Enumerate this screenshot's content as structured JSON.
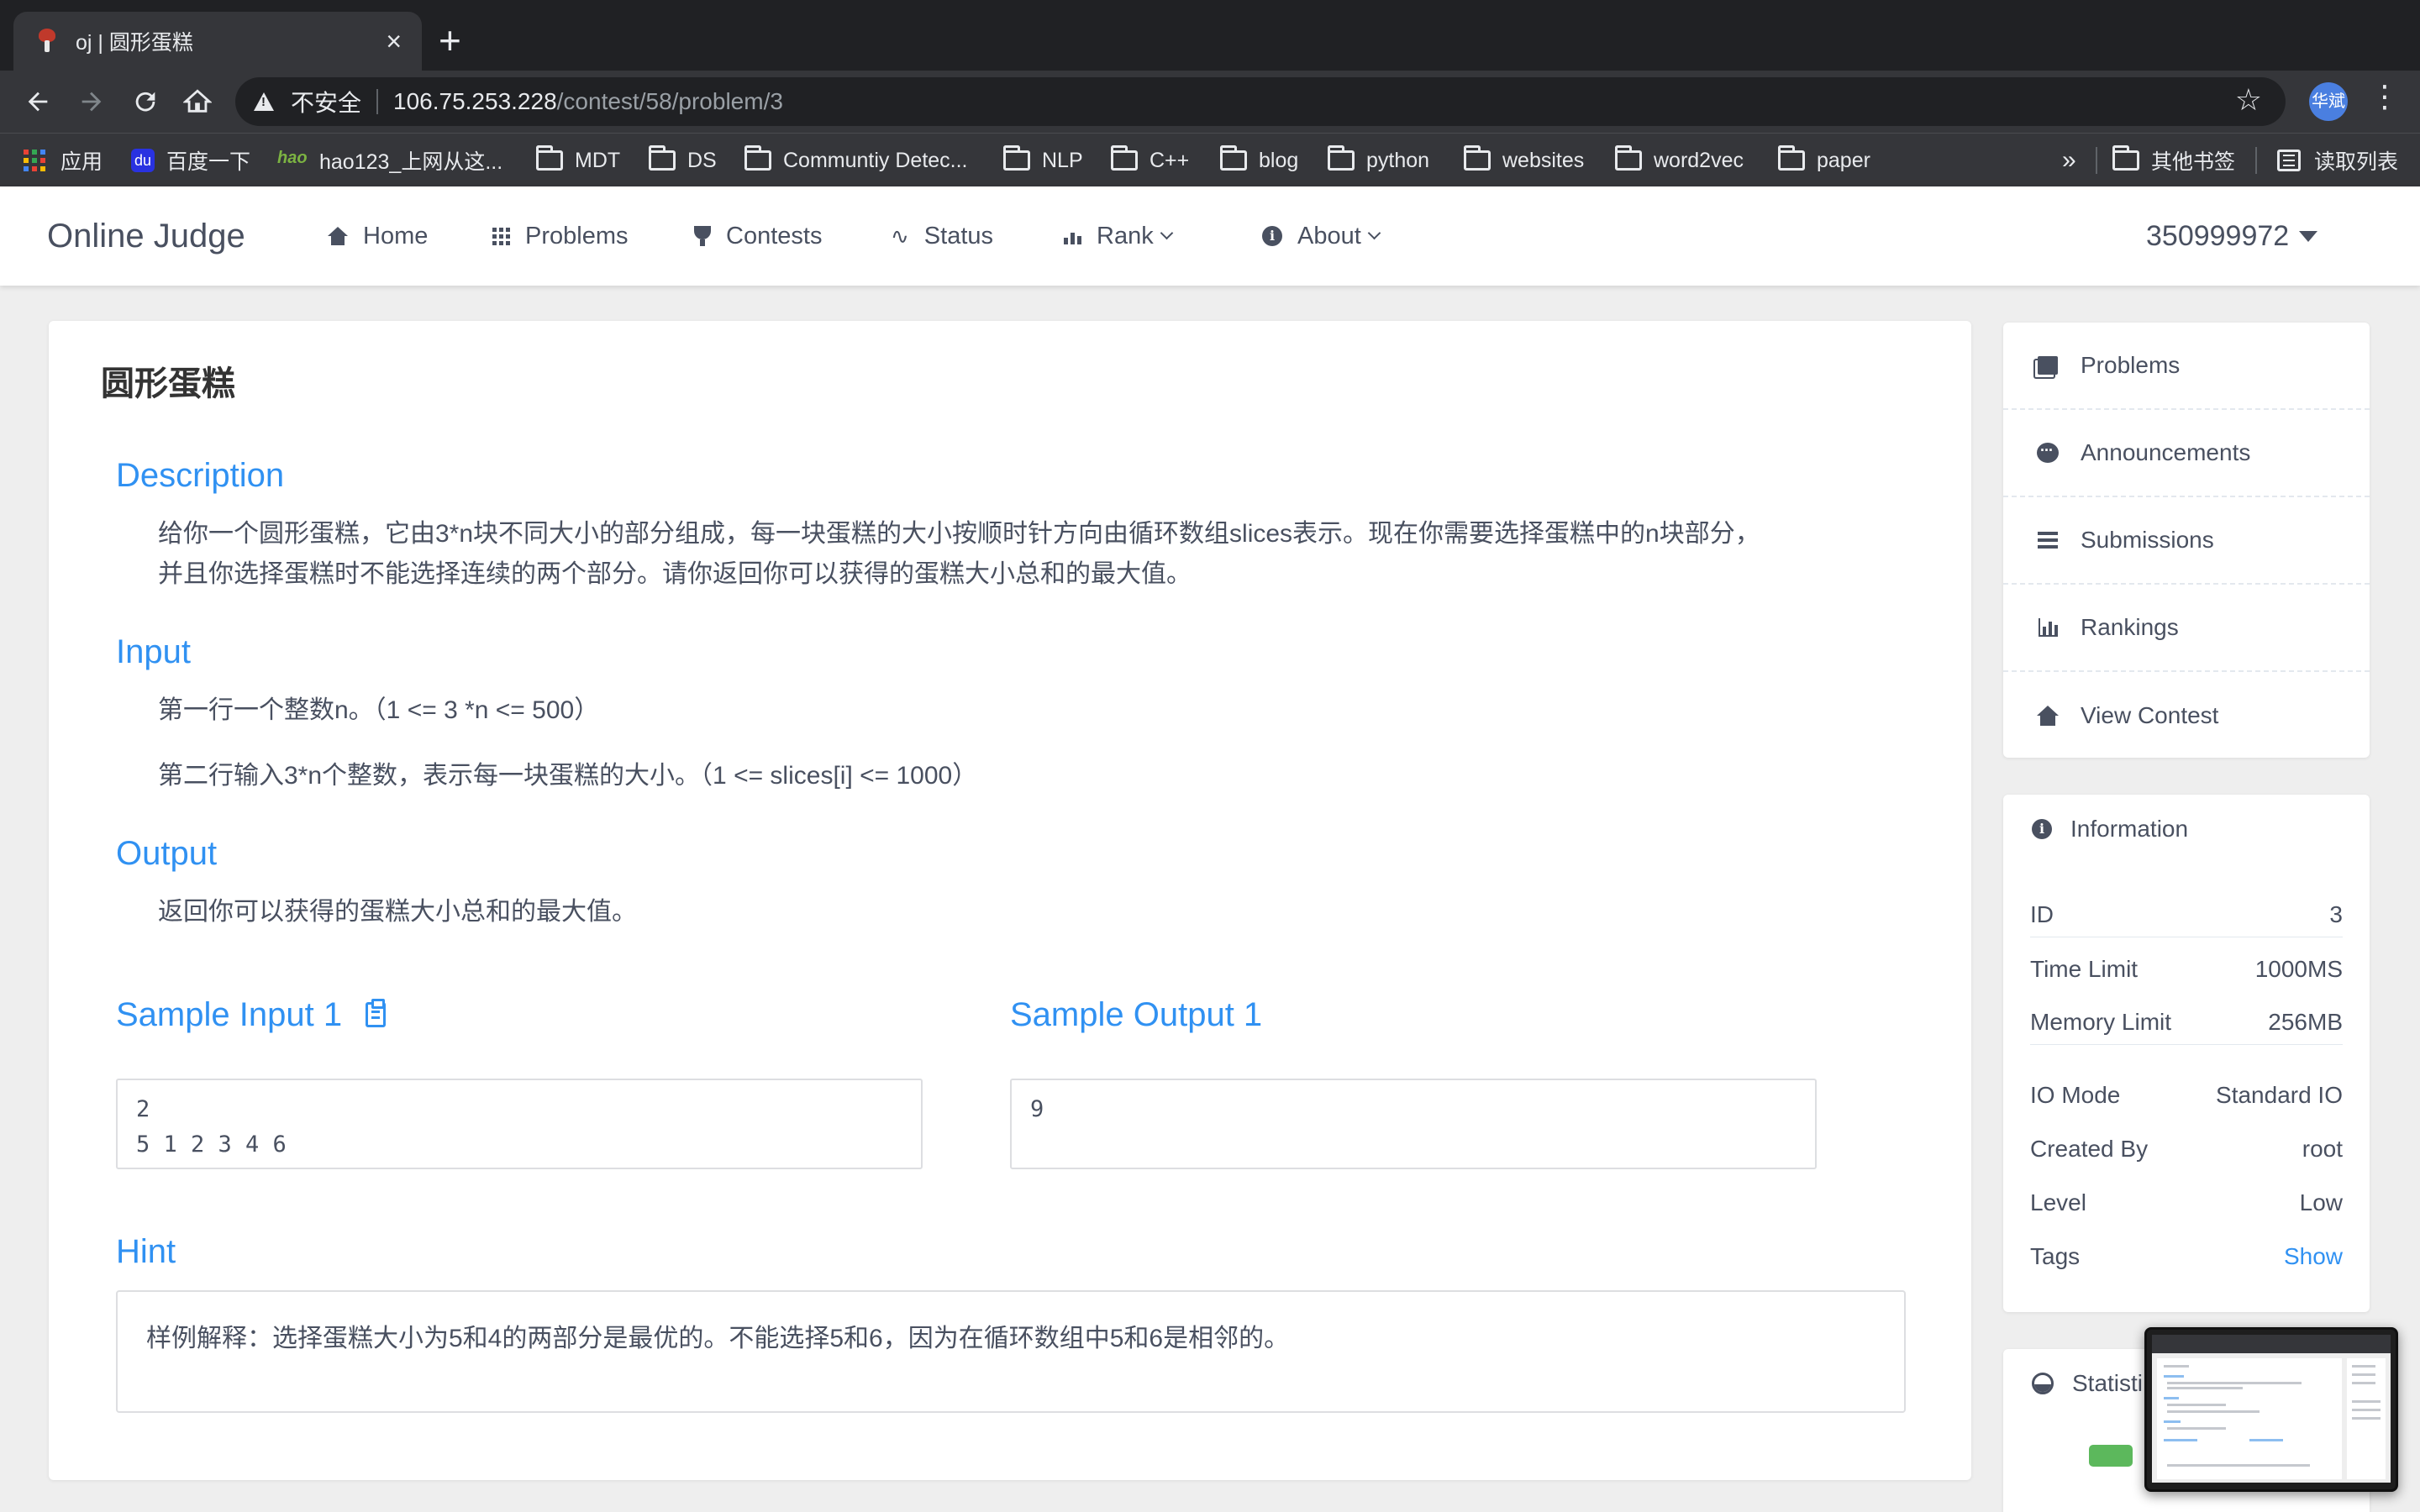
{
  "browser": {
    "tab_title": "oj | 圆形蛋糕",
    "tab_close": "×",
    "new_tab": "+",
    "security_label": "不安全",
    "url_host": "106.75.253.228",
    "url_path": "/contest/58/problem/3",
    "profile_initials": "华斌",
    "bookmarks": [
      {
        "label": "应用",
        "icon": "apps-grid-icon"
      },
      {
        "label": "百度一下",
        "icon": "baidu-icon"
      },
      {
        "label": "hao123_上网从这...",
        "icon": "hao123-icon"
      },
      {
        "label": "MDT",
        "icon": "folder-icon"
      },
      {
        "label": "DS",
        "icon": "folder-icon"
      },
      {
        "label": "Communtiy Detec...",
        "icon": "folder-icon"
      },
      {
        "label": "NLP",
        "icon": "folder-icon"
      },
      {
        "label": "C++",
        "icon": "folder-icon"
      },
      {
        "label": "blog",
        "icon": "folder-icon"
      },
      {
        "label": "python",
        "icon": "folder-icon"
      },
      {
        "label": "websites",
        "icon": "folder-icon"
      },
      {
        "label": "word2vec",
        "icon": "folder-icon"
      },
      {
        "label": "paper",
        "icon": "folder-icon"
      }
    ],
    "bookmarks_overflow": "»",
    "other_bookmarks": "其他书签",
    "reading_list": "读取列表"
  },
  "site": {
    "logo": "Online Judge",
    "nav": {
      "home": "Home",
      "problems": "Problems",
      "contests": "Contests",
      "status": "Status",
      "rank": "Rank",
      "about": "About"
    },
    "username": "350999972"
  },
  "problem": {
    "title": "圆形蛋糕",
    "description_title": "Description",
    "description_lines": [
      "给你一个圆形蛋糕，它由3*n块不同大小的部分组成，每一块蛋糕的大小按顺时针方向由循环数组slices表示。现在你需要选择蛋糕中的n块部分，",
      "并且你选择蛋糕时不能选择连续的两个部分。请你返回你可以获得的蛋糕大小总和的最大值。"
    ],
    "input_title": "Input",
    "input_lines": [
      "第一行一个整数n。（1 <= 3 *n <= 500）",
      "第二行输入3*n个整数，表示每一块蛋糕的大小。（1 <= slices[i] <= 1000）"
    ],
    "output_title": "Output",
    "output_text": "返回你可以获得的蛋糕大小总和的最大值。",
    "sample_input_title": "Sample Input 1",
    "sample_input": "2\n5 1 2 3 4 6",
    "sample_output_title": "Sample Output 1",
    "sample_output": "9",
    "hint_title": "Hint",
    "hint_text": "样例解释：选择蛋糕大小为5和4的两部分是最优的。不能选择5和6，因为在循环数组中5和6是相邻的。"
  },
  "sidebar": {
    "menu": [
      {
        "label": "Problems",
        "icon": "book-icon"
      },
      {
        "label": "Announcements",
        "icon": "chat-icon"
      },
      {
        "label": "Submissions",
        "icon": "list-icon"
      },
      {
        "label": "Rankings",
        "icon": "bar-chart-icon"
      },
      {
        "label": "View Contest",
        "icon": "home-icon"
      }
    ],
    "information_title": "Information",
    "info": [
      {
        "key": "ID",
        "value": "3"
      },
      {
        "key": "Time Limit",
        "value": "1000MS"
      },
      {
        "key": "Memory Limit",
        "value": "256MB"
      },
      {
        "key": "IO Mode",
        "value": "Standard IO"
      },
      {
        "key": "Created By",
        "value": "root"
      },
      {
        "key": "Level",
        "value": "Low"
      },
      {
        "key": "Tags",
        "value": "Show"
      }
    ],
    "statistic_title": "Statisti"
  },
  "colors": {
    "accent": "#3091f2",
    "text": "#495060",
    "legend_green": "#5cb85c"
  }
}
